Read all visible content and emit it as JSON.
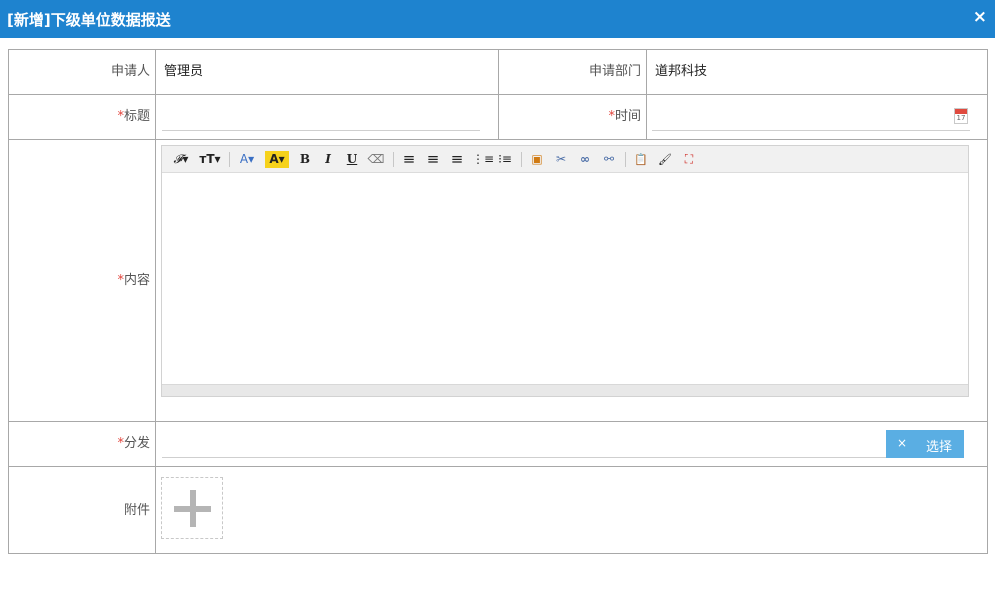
{
  "dialog": {
    "title": "[新增]下级单位数据报送",
    "close_glyph": "×"
  },
  "form": {
    "applicant_label": "申请人",
    "applicant_value": "管理员",
    "department_label": "申请部门",
    "department_value": "道邦科技",
    "required_mark": "*",
    "title_label": "标题",
    "title_value": "",
    "time_label": "时间",
    "time_value": "",
    "content_label": "内容",
    "distribute_label": "分发",
    "distribute_value": "",
    "clear_glyph": "×",
    "select_label": "选择",
    "attachment_label": "附件"
  },
  "calendar_icon_text": "17",
  "toolbar": {
    "buttons": [
      {
        "name": "font-family-icon",
        "glyph": "𝓕▾"
      },
      {
        "name": "font-size-icon",
        "glyph": "ᴛT▾"
      },
      {
        "name": "font-color-icon",
        "glyph": "A▾"
      },
      {
        "name": "highlight-color-icon",
        "glyph": "A▾"
      },
      {
        "name": "bold-icon",
        "glyph": "B"
      },
      {
        "name": "italic-icon",
        "glyph": "I"
      },
      {
        "name": "underline-icon",
        "glyph": "U"
      },
      {
        "name": "eraser-icon",
        "glyph": "⌫"
      },
      {
        "name": "align-left-icon",
        "glyph": "≡"
      },
      {
        "name": "align-center-icon",
        "glyph": "≡"
      },
      {
        "name": "align-right-icon",
        "glyph": "≡"
      },
      {
        "name": "ordered-list-icon",
        "glyph": "⋮≡"
      },
      {
        "name": "unordered-list-icon",
        "glyph": "⁝≡"
      },
      {
        "name": "insert-image-icon",
        "glyph": "▣"
      },
      {
        "name": "scissors-icon",
        "glyph": "✂"
      },
      {
        "name": "link-icon",
        "glyph": "∞"
      },
      {
        "name": "unlink-icon",
        "glyph": "⚯"
      },
      {
        "name": "paste-icon",
        "glyph": "📋"
      },
      {
        "name": "brush-icon",
        "glyph": "🖌"
      },
      {
        "name": "fullscreen-icon",
        "glyph": "⛶"
      }
    ]
  },
  "colors": {
    "title_bar": "#1e83cf",
    "required": "#e2443c",
    "select_button": "#5aaee3",
    "border": "#a8a8a8"
  }
}
